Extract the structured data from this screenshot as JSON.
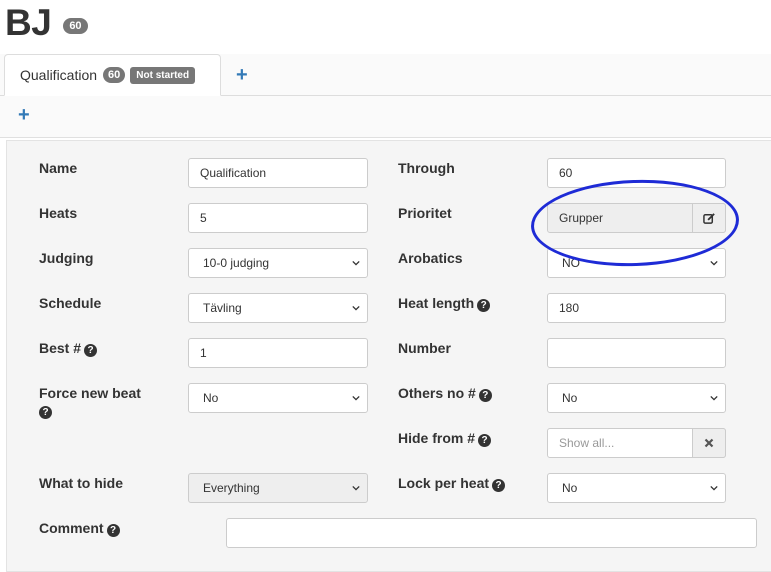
{
  "header": {
    "title": "BJ",
    "count": "60"
  },
  "tabs": [
    {
      "label": "Qualification",
      "count": "60",
      "status": "Not started"
    }
  ],
  "tab_add_label": "+",
  "subbar_add_label": "+",
  "form": {
    "name": {
      "label": "Name",
      "value": "Qualification"
    },
    "heats": {
      "label": "Heats",
      "value": "5"
    },
    "judging": {
      "label": "Judging",
      "value": "10-0 judging"
    },
    "schedule": {
      "label": "Schedule",
      "value": "Tävling"
    },
    "best": {
      "label": "Best #",
      "value": "1"
    },
    "force_new_beat": {
      "label": "Force new beat",
      "value": "No"
    },
    "what_to_hide": {
      "label": "What to hide",
      "value": "Everything"
    },
    "comment": {
      "label": "Comment",
      "value": ""
    },
    "through": {
      "label": "Through",
      "value": "60"
    },
    "prioritet": {
      "label": "Prioritet",
      "value": "Grupper"
    },
    "arobatics": {
      "label": "Arobatics",
      "value": "NO"
    },
    "heat_length": {
      "label": "Heat length",
      "value": "180"
    },
    "number": {
      "label": "Number",
      "value": ""
    },
    "others_no": {
      "label": "Others no #",
      "value": "No"
    },
    "hide_from": {
      "label": "Hide from #",
      "placeholder": "Show all..."
    },
    "lock_per_heat": {
      "label": "Lock per heat",
      "value": "No"
    }
  },
  "icons": {
    "help": "question-circle-icon",
    "edit": "edit-square-icon",
    "clear": "times-icon",
    "chevron": "chevron-down-icon"
  },
  "colors": {
    "accent": "#337ab7",
    "badge": "#777777",
    "annotation": "#1e2bd6"
  }
}
